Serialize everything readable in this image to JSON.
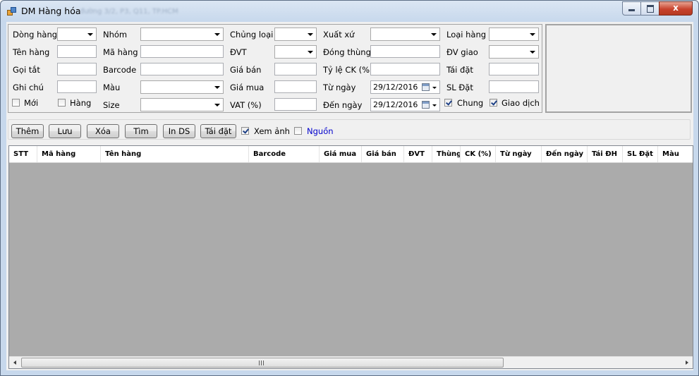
{
  "window": {
    "title": "DM Hàng hóa",
    "title_suffix_blurred": "đường 3/2, P3, Q11, TP.HCM",
    "controls": {
      "minimize": "minimize-icon",
      "maximize": "maximize-icon",
      "close": "x"
    }
  },
  "filters": {
    "dong_hang": {
      "label": "Dòng hàng",
      "value": ""
    },
    "nhom": {
      "label": "Nhóm",
      "value": ""
    },
    "chung_loai": {
      "label": "Chủng loại",
      "value": ""
    },
    "xuat_xu": {
      "label": "Xuất xứ",
      "value": ""
    },
    "loai_hang": {
      "label": "Loại hàng",
      "value": ""
    },
    "ten_hang": {
      "label": "Tên hàng",
      "value": ""
    },
    "ma_hang": {
      "label": "Mã hàng",
      "value": ""
    },
    "dvt": {
      "label": "ĐVT",
      "value": ""
    },
    "dong_thung": {
      "label": "Đóng thùng",
      "value": ""
    },
    "dv_giao": {
      "label": "ĐV giao",
      "value": ""
    },
    "goi_tat": {
      "label": "Gọi tắt",
      "value": ""
    },
    "barcode": {
      "label": "Barcode",
      "value": ""
    },
    "gia_ban": {
      "label": "Giá bán",
      "value": ""
    },
    "ty_le_ck": {
      "label": "Tỷ lệ CK (%)",
      "value": ""
    },
    "tai_dat": {
      "label": "Tái đặt",
      "value": ""
    },
    "ghi_chu": {
      "label": "Ghi chú",
      "value": ""
    },
    "mau": {
      "label": "Màu",
      "value": ""
    },
    "gia_mua": {
      "label": "Giá mua",
      "value": ""
    },
    "tu_ngay": {
      "label": "Từ ngày",
      "value": "29/12/2016"
    },
    "sl_dat": {
      "label": "SL Đặt",
      "value": ""
    },
    "size": {
      "label": "Size",
      "value": ""
    },
    "vat": {
      "label": "VAT (%)",
      "value": ""
    },
    "den_ngay": {
      "label": "Đến ngày",
      "value": "29/12/2016"
    },
    "moi": {
      "label": "Mới",
      "checked": false
    },
    "hang": {
      "label": "Hàng",
      "checked": false
    },
    "chung": {
      "label": "Chung",
      "checked": true
    },
    "giao_dich": {
      "label": "Giao dịch",
      "checked": true
    }
  },
  "toolbar": {
    "them": "Thêm",
    "luu": "Lưu",
    "xoa": "Xóa",
    "tim": "Tìm",
    "in_ds": "In DS",
    "tai_dat": "Tái đặt",
    "xem_anh": {
      "label": "Xem ảnh",
      "checked": true
    },
    "nguon": {
      "label": "Nguồn",
      "checked": false,
      "color": "#0000cc"
    }
  },
  "grid": {
    "columns": [
      "STT",
      "Mã hàng",
      "Tên hàng",
      "Barcode",
      "Giá mua",
      "Giá bán",
      "ĐVT",
      "Thùng",
      "CK (%)",
      "Từ ngày",
      "Đến ngày",
      "Tái ĐH",
      "SL Đặt",
      "Màu"
    ],
    "rows": [],
    "scroll_grip": "III"
  },
  "colors": {
    "grid_background": "#ababab",
    "form_background": "#f0f0f0"
  }
}
